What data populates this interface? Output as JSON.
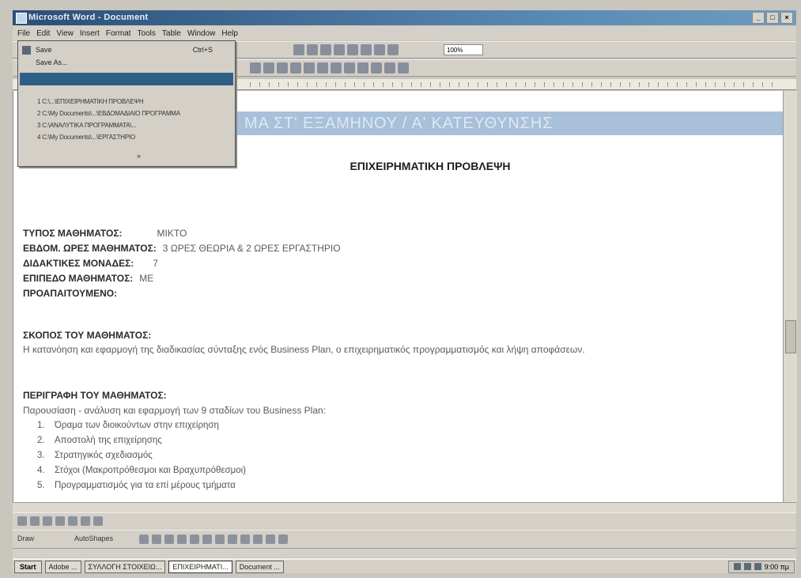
{
  "window": {
    "title": "Microsoft Word - Document"
  },
  "menubar": [
    "File",
    "Edit",
    "View",
    "Insert",
    "Format",
    "Tools",
    "Table",
    "Window",
    "Help"
  ],
  "toolbar": {
    "zoom": "100%"
  },
  "file_menu": {
    "items": [
      {
        "label": "Save",
        "shortcut": "Ctrl+S"
      },
      {
        "label": "Save As..."
      }
    ],
    "recent_files": [
      "1 C:\\...\\ΕΠΙΧΕΙΡΗΜΑΤΙΚΗ ΠΡΟΒΛΕΨΗ",
      "2 C:\\My Documents\\...\\ΕΒΔΟΜΑΔΙΑΙΟ ΠΡΟΓΡΑΜΜΑ",
      "3 C:\\ΑΝΑΛΥΤΙΚΑ ΠΡΟΓΡΑΜΜΑΤΑ\\...",
      "4 C:\\My Documents\\...\\ΕΡΓΑΣΤΗΡΙΟ"
    ],
    "more": "»"
  },
  "document": {
    "banner": "ΜΑ ΣΤ' ΕΞΑΜΗΝΟΥ / Α' ΚΑΤΕΥΘΥΝΣΗΣ",
    "title": "ΕΠΙΧΕΙΡΗΜΑΤΙΚΗ ΠΡΟΒΛΕΨΗ",
    "fields": [
      {
        "label": "ΤΥΠΟΣ ΜΑΘΗΜΑΤΟΣ:",
        "value": "ΜΙΚΤΟ"
      },
      {
        "label": "ΕΒΔΟΜ. ΩΡΕΣ ΜΑΘΗΜΑΤΟΣ:",
        "value": "3 ΩΡΕΣ ΘΕΩΡΙΑ & 2 ΩΡΕΣ ΕΡΓΑΣΤΗΡΙΟ"
      },
      {
        "label": "ΔΙΔΑΚΤΙΚΕΣ ΜΟΝΑΔΕΣ:",
        "value": "7"
      },
      {
        "label": "ΕΠΙΠΕΔΟ ΜΑΘΗΜΑΤΟΣ:",
        "value": "ΜΕ"
      },
      {
        "label": "ΠΡΟΑΠΑΙΤΟΥΜΕΝΟ:",
        "value": ""
      }
    ],
    "purpose_heading": "ΣΚΟΠΟΣ ΤΟΥ ΜΑΘΗΜΑΤΟΣ:",
    "purpose_text": "Η κατανόηση και εφαρμογή της διαδικασίας σύνταξης ενός Business Plan, ο επιχειρηματικός προγραμματισμός και λήψη αποφάσεων.",
    "description_heading": "ΠΕΡΙΓΡΑΦΗ ΤΟΥ ΜΑΘΗΜΑΤΟΣ:",
    "description_intro": "Παρουσίαση - ανάλυση και εφαρμογή των 9 σταδίων του Business Plan:",
    "stages": [
      {
        "n": "1.",
        "text": "Όραμα των διοικούντων στην επιχείρηση"
      },
      {
        "n": "2.",
        "text": "Αποστολή της επιχείρησης"
      },
      {
        "n": "3.",
        "text": "Στρατηγικός σχεδιασμός"
      },
      {
        "n": "4.",
        "text": "Στόχοι (Μακροπρόθεσμοι και Βραχυπρόθεσμοι)"
      },
      {
        "n": "5.",
        "text": "Προγραμματισμός για τα επί μέρους τμήματα"
      }
    ]
  },
  "drawing_toolbar": {
    "draw": "Draw",
    "autoshapes": "AutoShapes"
  },
  "taskbar": {
    "start": "Start",
    "tasks": [
      "Adobe ...",
      "ΣΥΛΛΟΓΗ ΣΤΟΙΧΕΙΩ...",
      "ΕΠΙΧΕΙΡΗΜΑΤΙ...",
      "Document ..."
    ],
    "clock": "9:00 πμ"
  }
}
